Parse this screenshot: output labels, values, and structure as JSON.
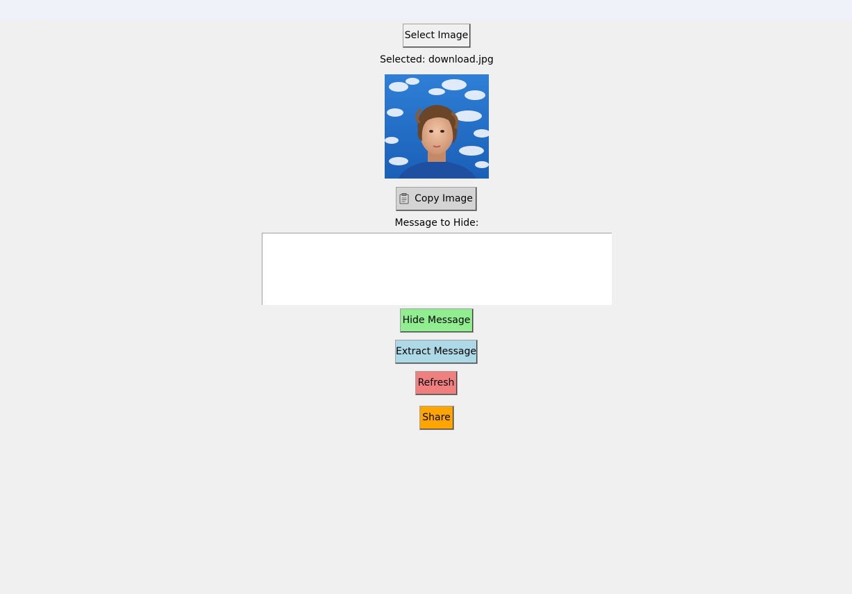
{
  "buttons": {
    "select_image": "Select Image",
    "copy_image": "Copy Image",
    "hide_message": "Hide Message",
    "extract_message": "Extract Message",
    "refresh": "Refresh",
    "share": "Share"
  },
  "selected_file": "Selected: download.jpg",
  "message_label": "Message to Hide:",
  "message_value": "",
  "icons": {
    "copy": "clipboard-icon"
  },
  "colors": {
    "window_bg": "#f0f0f0",
    "hide_button": "#90ee90",
    "extract_button": "#add8e6",
    "refresh_button": "#f08080",
    "share_button": "#ffa500"
  }
}
